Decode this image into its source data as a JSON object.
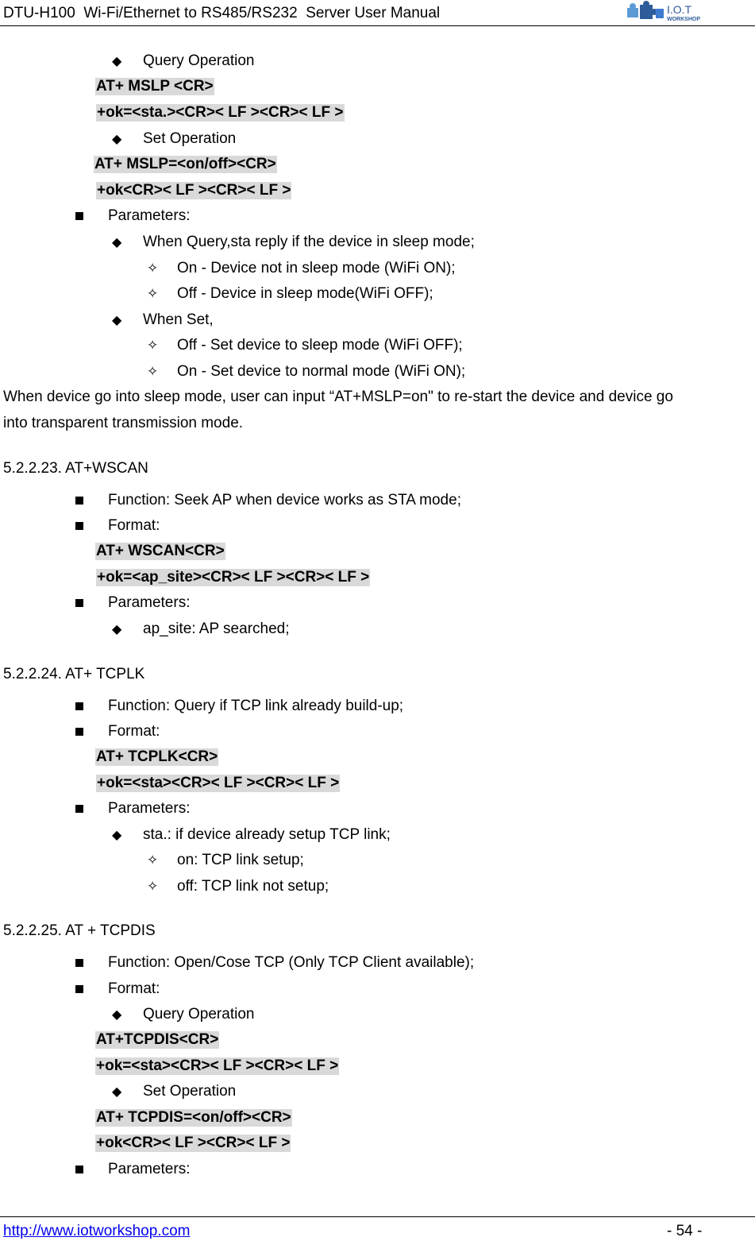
{
  "header": {
    "title": "DTU-H100  Wi-Fi/Ethernet to RS485/RS232  Server User Manual",
    "logo_text": "I.O.T",
    "logo_subtext": "WORKSHOP"
  },
  "footer": {
    "link": "http://www.iotworkshop.com",
    "page": "- 54 -"
  },
  "icons": {
    "square_bullet": "■",
    "diamond_bullet": "◆",
    "star_bullet": "✧"
  },
  "mslp": {
    "query_label": "Query Operation",
    "query_cmd": "AT+ MSLP <CR>",
    "query_resp": "+ok=<sta.><CR>< LF ><CR>< LF >",
    "set_label": "Set Operation",
    "set_cmd": "AT+ MSLP=<on/off><CR>",
    "set_resp": "+ok<CR>< LF ><CR>< LF >",
    "params_label": "Parameters:",
    "p1": "When Query,sta reply if the device in sleep mode;",
    "p1a": "On - Device not in sleep mode (WiFi ON);",
    "p1b": "Off - Device in sleep mode(WiFi OFF);",
    "p2": "When Set,",
    "p2a": "Off - Set device to sleep mode (WiFi OFF);",
    "p2b": "On - Set device to normal mode (WiFi ON);",
    "note_line1": "When device go into sleep mode, user can input “AT+MSLP=on\" to re-start the device and device go",
    "note_line2": "into transparent transmission mode."
  },
  "wscan": {
    "heading": "5.2.2.23. AT+WSCAN",
    "function": "Function: Seek AP when device works as STA mode;",
    "format_label": "Format:",
    "cmd": "AT+ WSCAN<CR>",
    "resp": "+ok=<ap_site><CR>< LF ><CR>< LF >",
    "params_label": "Parameters:",
    "p1": "ap_site: AP searched;"
  },
  "tcplk": {
    "heading": "5.2.2.24. AT+ TCPLK",
    "function": "Function: Query if TCP link already build-up;",
    "format_label": "Format:",
    "cmd": "AT+ TCPLK<CR>",
    "resp": "+ok=<sta><CR>< LF ><CR>< LF >",
    "params_label": "Parameters:",
    "p1": "sta.: if device already setup TCP link;",
    "p1a": "on: TCP link setup;",
    "p1b": "off: TCP link not setup;"
  },
  "tcpdis": {
    "heading": "5.2.2.25. AT + TCPDIS",
    "function": "Function: Open/Cose TCP (Only TCP Client available);",
    "format_label": "Format:",
    "query_label": "Query Operation",
    "query_cmd": "AT+TCPDIS<CR>",
    "query_resp": "+ok=<sta><CR>< LF ><CR>< LF >",
    "set_label": "Set Operation",
    "set_cmd": "AT+ TCPDIS=<on/off><CR>",
    "set_resp": "+ok<CR>< LF ><CR>< LF >",
    "params_label": "Parameters:"
  }
}
